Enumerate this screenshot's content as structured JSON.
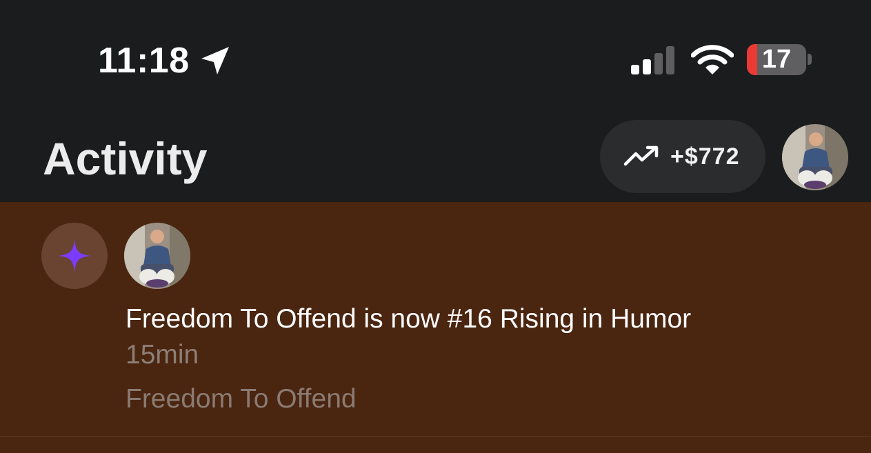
{
  "status_bar": {
    "time": "11:18",
    "location_icon": "location-arrow-icon",
    "signal_icon": "cellular-signal-icon",
    "signal_bars_active": 2,
    "signal_bars_total": 4,
    "wifi_icon": "wifi-icon",
    "battery_level": 17,
    "battery_label": "17",
    "battery_fill_color": "#eb3a34"
  },
  "header": {
    "title": "Activity",
    "earnings": {
      "icon": "trending-up-icon",
      "label": "+$772"
    },
    "profile_avatar": "profile-avatar"
  },
  "activity": {
    "background_color": "#4a2510",
    "items": [
      {
        "type_icon": "sparkle-icon",
        "type_icon_color": "#7b3cff",
        "avatar": "publication-avatar",
        "message": "Freedom To Offend is now #16 Rising in Humor",
        "time": "15min",
        "publication": "Freedom To Offend"
      }
    ]
  }
}
